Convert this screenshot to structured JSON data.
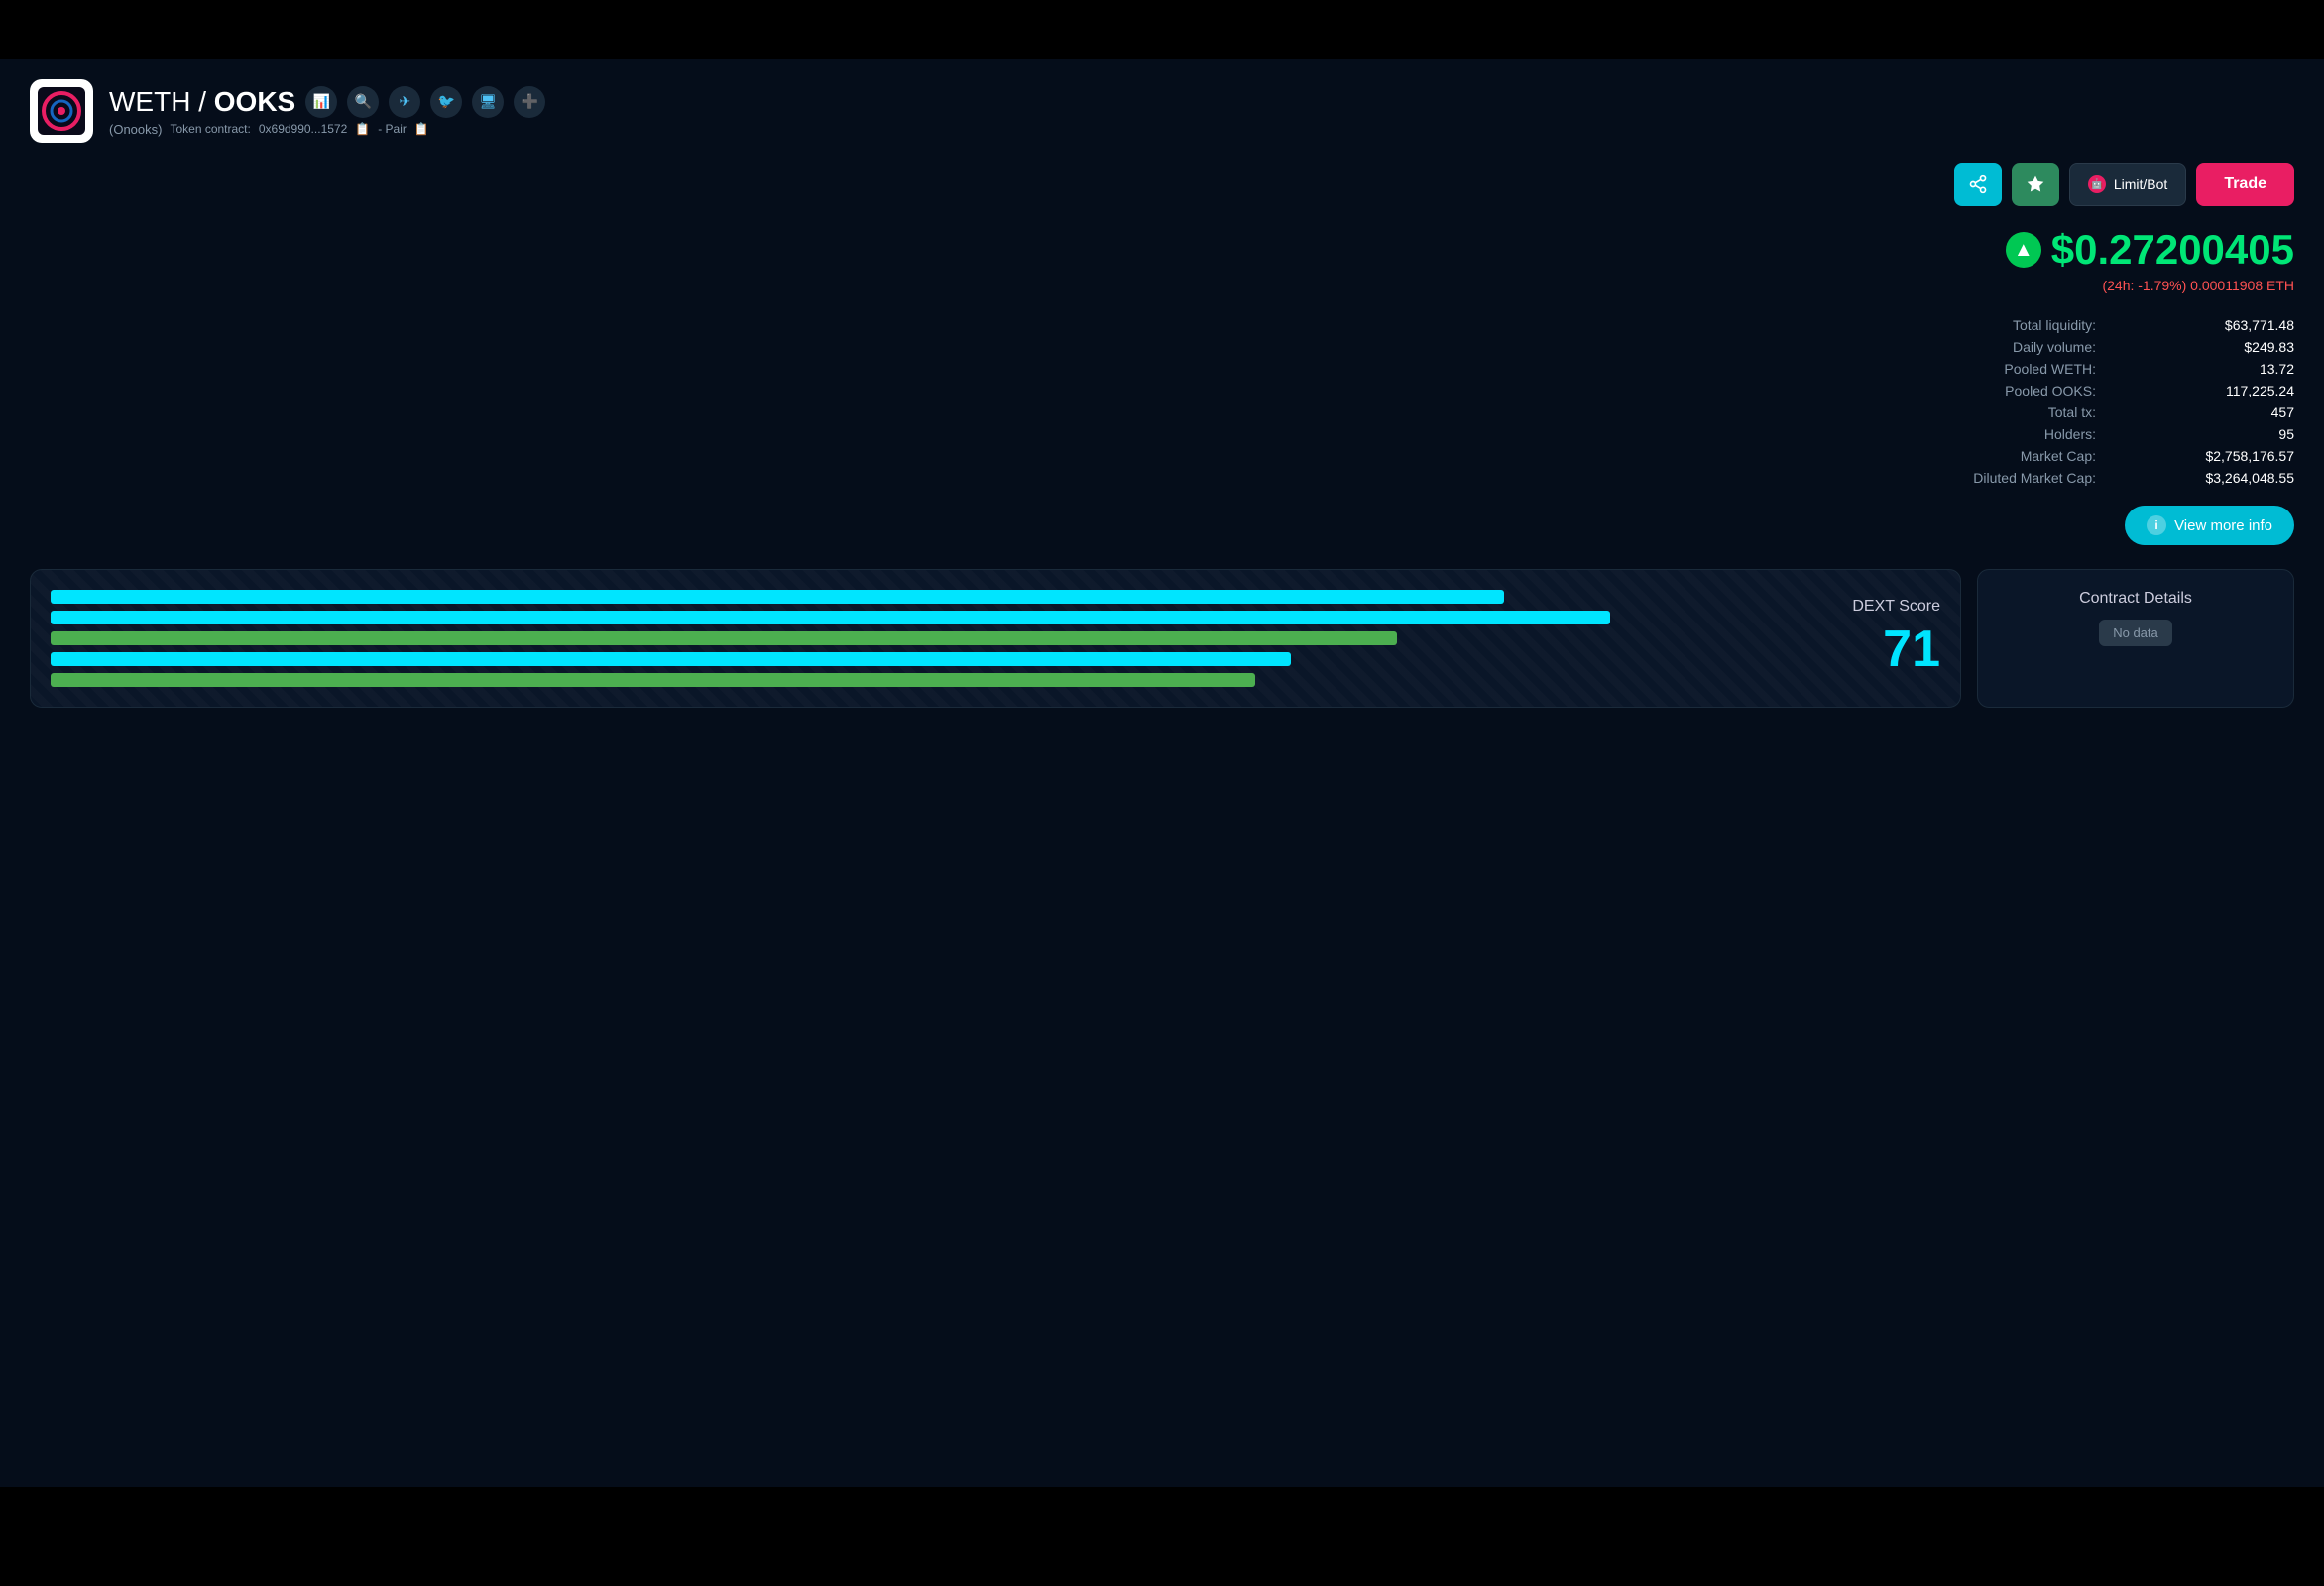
{
  "header": {
    "token_pair": "WETH / ",
    "token_name_bold": "OOKS",
    "token_full_name": "(Onooks)",
    "contract_label": "Token contract:",
    "contract_address": "0x69d990...1572",
    "pair_label": "- Pair",
    "icons": [
      "chart-icon",
      "moonscan-icon",
      "telegram-icon",
      "twitter-icon",
      "monitor-icon",
      "plus-icon"
    ]
  },
  "actions": {
    "share_label": "⇄",
    "star_label": "★",
    "limitbot_label": "Limit/Bot",
    "trade_label": "Trade"
  },
  "price": {
    "value": "$0.27200405",
    "change": "(24h: -1.79%) 0.00011908 ETH"
  },
  "stats": [
    {
      "label": "Total liquidity:",
      "value": "$63,771.48"
    },
    {
      "label": "Daily volume:",
      "value": "$249.83"
    },
    {
      "label": "Pooled WETH:",
      "value": "13.72"
    },
    {
      "label": "Pooled OOKS:",
      "value": "117,225.24"
    },
    {
      "label": "Total tx:",
      "value": "457"
    },
    {
      "label": "Holders:",
      "value": "95"
    },
    {
      "label": "Market Cap:",
      "value": "$2,758,176.57"
    },
    {
      "label": "Diluted Market Cap:",
      "value": "$3,264,048.55"
    }
  ],
  "view_more": {
    "label": "View more info"
  },
  "dext": {
    "label": "DEXT Score",
    "score": "71",
    "bars": [
      {
        "width": 82,
        "color": "#00e5ff"
      },
      {
        "width": 88,
        "color": "#00e5ff"
      },
      {
        "width": 76,
        "color": "#4caf50"
      },
      {
        "width": 70,
        "color": "#00e5ff"
      },
      {
        "width": 68,
        "color": "#4caf50"
      }
    ]
  },
  "contract": {
    "title": "Contract Details",
    "no_data": "No data"
  }
}
